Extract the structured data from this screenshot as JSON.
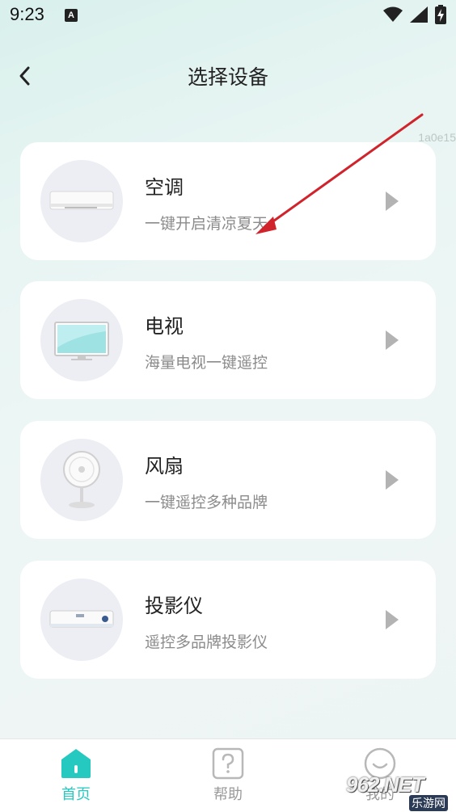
{
  "status_bar": {
    "time": "9:23",
    "notification_letter": "A",
    "icons": [
      "wifi-icon",
      "signal-icon",
      "battery-charging-icon"
    ]
  },
  "header": {
    "title": "选择设备",
    "back_icon": "chevron-left-icon"
  },
  "watermark_id": "1a0e15",
  "devices": [
    {
      "title": "空调",
      "subtitle": "一键开启清凉夏天",
      "icon": "air-conditioner-icon"
    },
    {
      "title": "电视",
      "subtitle": "海量电视一键遥控",
      "icon": "tv-icon"
    },
    {
      "title": "风扇",
      "subtitle": "一键遥控多种品牌",
      "icon": "fan-icon"
    },
    {
      "title": "投影仪",
      "subtitle": "遥控多品牌投影仪",
      "icon": "projector-icon"
    }
  ],
  "bottom_nav": {
    "items": [
      {
        "label": "首页",
        "icon": "home-icon",
        "active": true
      },
      {
        "label": "帮助",
        "icon": "help-icon",
        "active": false
      },
      {
        "label": "我的",
        "icon": "smile-icon",
        "active": false
      }
    ]
  },
  "watermark_logo": {
    "main": "962.NET",
    "sub": "乐游网"
  },
  "colors": {
    "accent": "#26c9c0",
    "annotation_arrow": "#d0232b"
  }
}
